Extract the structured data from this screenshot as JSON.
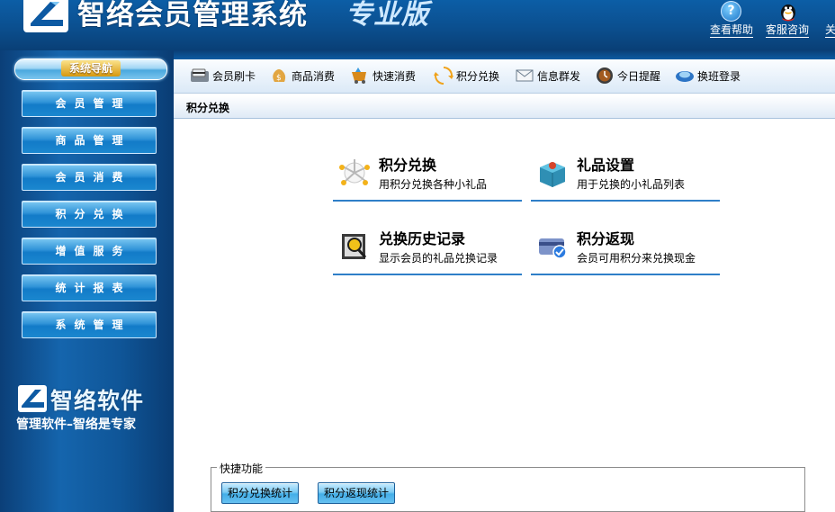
{
  "header": {
    "title": "智络会员管理系统",
    "edition": "专业版",
    "links": [
      {
        "label": "查看帮助",
        "icon": "help-icon"
      },
      {
        "label": "客服咨询",
        "icon": "qq-icon"
      },
      {
        "label": "关"
      }
    ]
  },
  "sidebar": {
    "nav_title": "系统导航",
    "items": [
      {
        "label": "会员管理"
      },
      {
        "label": "商品管理"
      },
      {
        "label": "会员消费"
      },
      {
        "label": "积分兑换"
      },
      {
        "label": "增值服务"
      },
      {
        "label": "统计报表"
      },
      {
        "label": "系统管理"
      }
    ],
    "brand_name": "智络软件",
    "brand_slogan": "管理软件–智络是专家"
  },
  "toolbar": {
    "items": [
      {
        "label": "会员刷卡",
        "icon": "card-reader-icon"
      },
      {
        "label": "商品消费",
        "icon": "money-bag-icon"
      },
      {
        "label": "快速消费",
        "icon": "fast-purchase-icon"
      },
      {
        "label": "积分兑换",
        "icon": "exchange-icon"
      },
      {
        "label": "信息群发",
        "icon": "envelope-icon"
      },
      {
        "label": "今日提醒",
        "icon": "clock-icon"
      },
      {
        "label": "换班登录",
        "icon": "shift-login-icon"
      }
    ]
  },
  "section": {
    "title": "积分兑换"
  },
  "functions": [
    {
      "title": "积分兑换",
      "desc": "用积分兑换各种小礼品",
      "icon": "points-exchange-icon"
    },
    {
      "title": "礼品设置",
      "desc": "用于兑换的小礼品列表",
      "icon": "gift-settings-icon"
    },
    {
      "title": "兑换历史记录",
      "desc": "显示会员的礼品兑换记录",
      "icon": "history-search-icon"
    },
    {
      "title": "积分返现",
      "desc": "会员可用积分来兑换现金",
      "icon": "cashback-card-icon"
    }
  ],
  "quick": {
    "legend": "快捷功能",
    "buttons": [
      {
        "label": "积分兑换统计"
      },
      {
        "label": "积分返现统计"
      }
    ]
  }
}
